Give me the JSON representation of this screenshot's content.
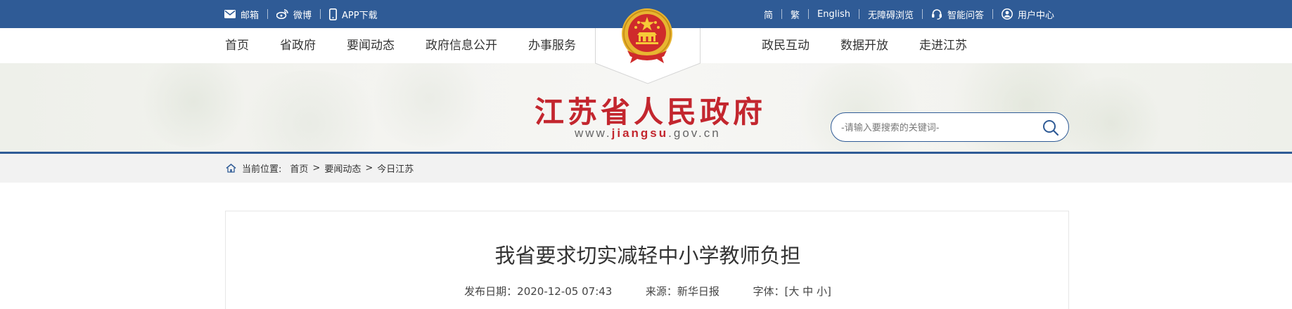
{
  "topbar": {
    "left": [
      {
        "icon": "mail-icon",
        "label": "邮箱"
      },
      {
        "icon": "weibo-icon",
        "label": "微博"
      },
      {
        "icon": "phone-icon",
        "label": "APP下载"
      }
    ],
    "right": [
      {
        "label": "简"
      },
      {
        "label": "繁"
      },
      {
        "label": "English"
      },
      {
        "label": "无障碍浏览"
      },
      {
        "icon": "headset-icon",
        "label": "智能问答"
      },
      {
        "icon": "user-icon",
        "label": "用户中心"
      }
    ]
  },
  "nav": {
    "left": [
      "首页",
      "省政府",
      "要闻动态",
      "政府信息公开",
      "办事服务"
    ],
    "right": [
      "政民互动",
      "数据开放",
      "走进江苏"
    ]
  },
  "brand": {
    "title": "江苏省人民政府",
    "url_prefix": "www.",
    "url_highlight": "jiangsu",
    "url_suffix": ".gov.cn"
  },
  "search": {
    "placeholder": "-请输入要搜索的关键词-",
    "button_icon": "search-icon"
  },
  "breadcrumb": {
    "label": "当前位置:",
    "items": [
      "首页",
      "要闻动态",
      "今日江苏"
    ],
    "separator": ">"
  },
  "article": {
    "title": "我省要求切实减轻中小学教师负担",
    "date_label": "发布日期：",
    "date": "2020-12-05 07:43",
    "source_label": "来源：",
    "source": "新华日报",
    "font_label": "字体：",
    "font_open": "[",
    "font_sizes": [
      "大",
      "中",
      "小"
    ],
    "font_close": "]"
  },
  "colors": {
    "primary_blue": "#2f5b96",
    "brand_red": "#c3262e",
    "emblem_gold": "#e8b531"
  }
}
